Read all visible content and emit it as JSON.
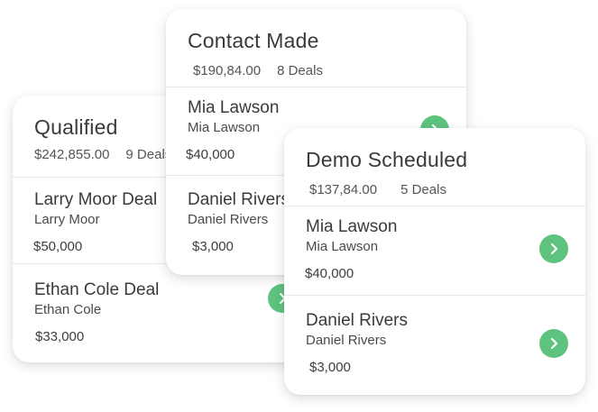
{
  "colors": {
    "accent_green": "#5ec37f",
    "card_bg": "#ffffff",
    "text": "#3a3a3a"
  },
  "cards": {
    "qualified": {
      "title": "Qualified",
      "amount": "$242,855.00",
      "deals_count": "9 Deals",
      "deals": [
        {
          "name": "Larry Moor Deal",
          "contact": "Larry Moor",
          "amount": "$50,000",
          "icon": "chevron-right-icon"
        },
        {
          "name": "Ethan Cole Deal",
          "contact": "Ethan Cole",
          "amount": "$33,000",
          "icon": "chevron-right-icon"
        }
      ]
    },
    "contact_made": {
      "title": "Contact Made",
      "amount": "$190,84.00",
      "deals_count": "8 Deals",
      "deals": [
        {
          "name": "Mia Lawson",
          "contact": "Mia Lawson",
          "amount": "$40,000",
          "icon": "chevron-right-icon"
        },
        {
          "name": "Daniel Rivers",
          "contact": "Daniel Rivers",
          "amount": "$3,000",
          "icon": "chevron-right-icon"
        }
      ]
    },
    "demo_scheduled": {
      "title": "Demo Scheduled",
      "amount": "$137,84.00",
      "deals_count": "5 Deals",
      "deals": [
        {
          "name": "Mia Lawson",
          "contact": "Mia Lawson",
          "amount": "$40,000",
          "icon": "chevron-right-icon"
        },
        {
          "name": "Daniel Rivers",
          "contact": "Daniel Rivers",
          "amount": "$3,000",
          "icon": "chevron-right-icon"
        }
      ]
    }
  }
}
